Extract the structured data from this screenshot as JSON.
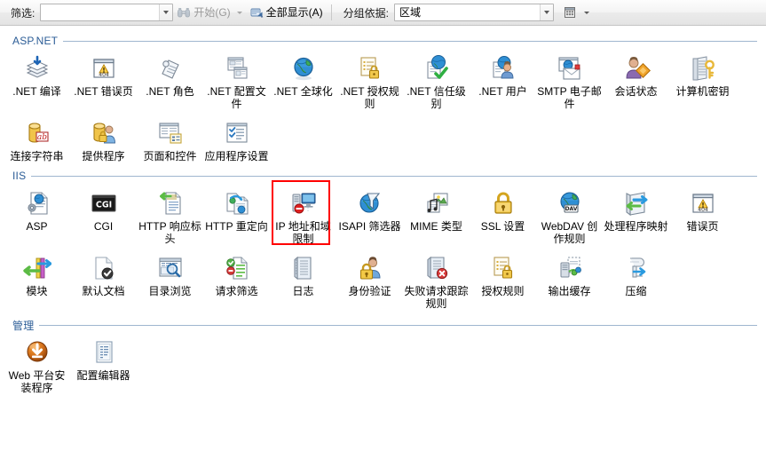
{
  "toolbar": {
    "filter_label": "筛选:",
    "filter_value": "",
    "start_label": "开始(G)",
    "start_mnemonic": "G",
    "show_all_label": "全部显示(A)",
    "show_all_mnemonic": "A",
    "group_by_label": "分组依据:",
    "group_by_value": "区域",
    "view_icon": "view-options-icon",
    "binoculars_icon": "binoculars-icon",
    "show_all_icon": "show-all-icon"
  },
  "sections": [
    {
      "title": "ASP.NET",
      "items": [
        {
          "label": ".NET 编译",
          "icon": "net-compilation-icon"
        },
        {
          "label": ".NET 错误页",
          "icon": "net-error-pages-icon"
        },
        {
          "label": ".NET 角色",
          "icon": "net-roles-icon"
        },
        {
          "label": ".NET 配置文件",
          "icon": "net-profile-icon"
        },
        {
          "label": ".NET 全球化",
          "icon": "net-globalization-icon"
        },
        {
          "label": ".NET 授权规则",
          "icon": "net-authorization-rules-icon"
        },
        {
          "label": ".NET 信任级别",
          "icon": "net-trust-levels-icon"
        },
        {
          "label": ".NET 用户",
          "icon": "net-users-icon"
        },
        {
          "label": "SMTP 电子邮件",
          "icon": "smtp-email-icon"
        },
        {
          "label": "会话状态",
          "icon": "session-state-icon"
        },
        {
          "label": "计算机密钥",
          "icon": "machine-key-icon"
        },
        {
          "label": "连接字符串",
          "icon": "connection-strings-icon"
        },
        {
          "label": "提供程序",
          "icon": "providers-icon"
        },
        {
          "label": "页面和控件",
          "icon": "pages-and-controls-icon"
        },
        {
          "label": "应用程序设置",
          "icon": "application-settings-icon"
        }
      ]
    },
    {
      "title": "IIS",
      "items": [
        {
          "label": "ASP",
          "icon": "asp-icon"
        },
        {
          "label": "CGI",
          "icon": "cgi-icon"
        },
        {
          "label": "HTTP 响应标头",
          "icon": "http-response-headers-icon"
        },
        {
          "label": "HTTP 重定向",
          "icon": "http-redirect-icon"
        },
        {
          "label": "IP 地址和域限制",
          "icon": "ip-address-domain-restrictions-icon"
        },
        {
          "label": "ISAPI 筛选器",
          "icon": "isapi-filters-icon"
        },
        {
          "label": "MIME 类型",
          "icon": "mime-types-icon"
        },
        {
          "label": "SSL 设置",
          "icon": "ssl-settings-icon"
        },
        {
          "label": "WebDAV 创作规则",
          "icon": "webdav-authoring-rules-icon"
        },
        {
          "label": "处理程序映射",
          "icon": "handler-mappings-icon"
        },
        {
          "label": "错误页",
          "icon": "error-pages-icon"
        },
        {
          "label": "模块",
          "icon": "modules-icon"
        },
        {
          "label": "默认文档",
          "icon": "default-document-icon"
        },
        {
          "label": "目录浏览",
          "icon": "directory-browsing-icon"
        },
        {
          "label": "请求筛选",
          "icon": "request-filtering-icon"
        },
        {
          "label": "日志",
          "icon": "logging-icon",
          "highlighted": true
        },
        {
          "label": "身份验证",
          "icon": "authentication-icon"
        },
        {
          "label": "失败请求跟踪规则",
          "icon": "failed-request-tracing-rules-icon"
        },
        {
          "label": "授权规则",
          "icon": "authorization-rules-icon"
        },
        {
          "label": "输出缓存",
          "icon": "output-caching-icon"
        },
        {
          "label": "压缩",
          "icon": "compression-icon"
        }
      ]
    },
    {
      "title": "管理",
      "items": [
        {
          "label": "Web 平台安装程序",
          "icon": "web-platform-installer-icon"
        },
        {
          "label": "配置编辑器",
          "icon": "configuration-editor-icon"
        }
      ]
    }
  ],
  "colors": {
    "section_title": "#2b5c96",
    "highlight": "#ff0000",
    "toolbar_bg": "#ebebeb"
  }
}
